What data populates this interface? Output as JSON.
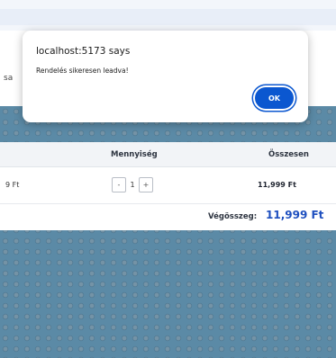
{
  "background": {
    "header_partial_text": "sa"
  },
  "cart_table": {
    "columns": {
      "quantity": "Mennyiség",
      "total": "Összesen"
    },
    "rows": [
      {
        "price_partial": "9 Ft",
        "decrement_label": "-",
        "quantity": "1",
        "increment_label": "+",
        "line_total": "11,999 Ft"
      }
    ],
    "grand_total_label": "Végösszeg:",
    "grand_total_value": "11,999 Ft"
  },
  "alert_dialog": {
    "title": "localhost:5173 says",
    "message": "Rendelés sikeresen leadva!",
    "ok_label": "OK"
  },
  "colors": {
    "accent_blue": "#0b57d0",
    "total_blue": "#1e4fbf",
    "lego_background": "#5b8aa6"
  }
}
